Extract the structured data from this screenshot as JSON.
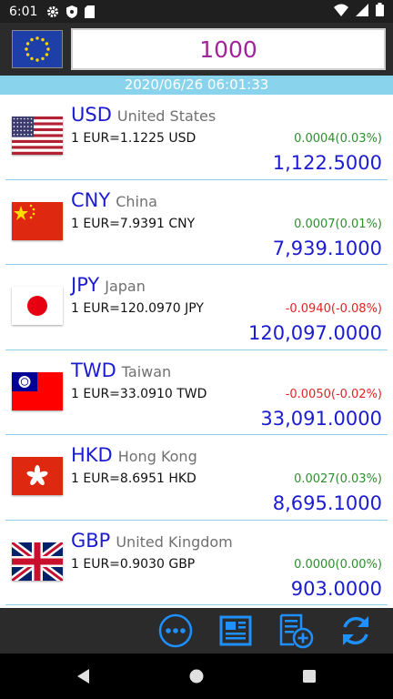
{
  "status_bar": {
    "time": "6:01",
    "icons": [
      "gear-icon",
      "shield-icon",
      "sd-card-icon",
      "wifi-icon",
      "cell-signal-icon",
      "battery-icon"
    ]
  },
  "converter": {
    "base_currency_flag": "eu-flag",
    "amount": "1000",
    "timestamp": "2020/06/26 06:01:33"
  },
  "rates": [
    {
      "code": "USD",
      "name": "United States",
      "rate": "1 EUR=1.1225 USD",
      "change": "0.0004(0.03%)",
      "direction": "up",
      "value": "1,122.5000",
      "flag": "us-flag"
    },
    {
      "code": "CNY",
      "name": "China",
      "rate": "1 EUR=7.9391 CNY",
      "change": "0.0007(0.01%)",
      "direction": "up",
      "value": "7,939.1000",
      "flag": "cn-flag"
    },
    {
      "code": "JPY",
      "name": "Japan",
      "rate": "1 EUR=120.0970 JPY",
      "change": "-0.0940(-0.08%)",
      "direction": "down",
      "value": "120,097.0000",
      "flag": "jp-flag"
    },
    {
      "code": "TWD",
      "name": "Taiwan",
      "rate": "1 EUR=33.0910 TWD",
      "change": "-0.0050(-0.02%)",
      "direction": "down",
      "value": "33,091.0000",
      "flag": "tw-flag"
    },
    {
      "code": "HKD",
      "name": "Hong Kong",
      "rate": "1 EUR=8.6951 HKD",
      "change": "0.0027(0.03%)",
      "direction": "up",
      "value": "8,695.1000",
      "flag": "hk-flag"
    },
    {
      "code": "GBP",
      "name": "United Kingdom",
      "rate": "1 EUR=0.9030 GBP",
      "change": "0.0000(0.00%)",
      "direction": "up",
      "value": "903.0000",
      "flag": "gb-flag"
    }
  ],
  "toolbar": {
    "buttons": [
      "more-icon",
      "news-icon",
      "add-currency-icon",
      "refresh-icon"
    ]
  },
  "colors": {
    "accent_blue": "#1b1bd0",
    "amount_purple": "#a0259a",
    "up_green": "#2e8f2e",
    "down_red": "#e02424",
    "date_strip": "#8ad3ec",
    "toolbar_icon": "#1e90ff"
  }
}
